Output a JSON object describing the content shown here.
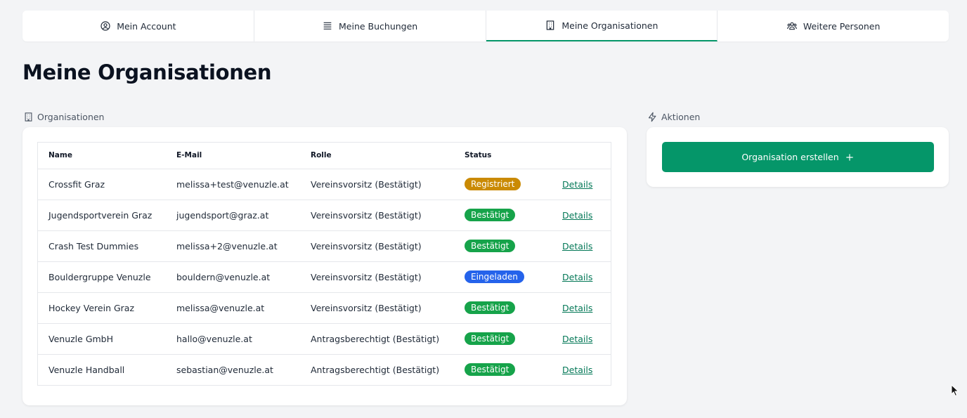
{
  "tabs": [
    {
      "label": "Mein Account",
      "icon": "user-circle-icon"
    },
    {
      "label": "Meine Buchungen",
      "icon": "list-icon"
    },
    {
      "label": "Meine Organisationen",
      "icon": "building-icon",
      "active": true
    },
    {
      "label": "Weitere Personen",
      "icon": "users-icon"
    }
  ],
  "page_title": "Meine Organisationen",
  "orgs_section": {
    "label": "Organisationen",
    "columns": [
      "Name",
      "E-Mail",
      "Rolle",
      "Status",
      ""
    ],
    "rows": [
      {
        "name": "Crossfit Graz",
        "email": "melissa+test@venuzle.at",
        "role": "Vereinsvorsitz (Bestätigt)",
        "status": "Registriert",
        "status_color": "#ca8a04",
        "action": "Details"
      },
      {
        "name": "Jugendsportverein Graz",
        "email": "jugendsport@graz.at",
        "role": "Vereinsvorsitz (Bestätigt)",
        "status": "Bestätigt",
        "status_color": "#16a34a",
        "action": "Details"
      },
      {
        "name": "Crash Test Dummies",
        "email": "melissa+2@venuzle.at",
        "role": "Vereinsvorsitz (Bestätigt)",
        "status": "Bestätigt",
        "status_color": "#16a34a",
        "action": "Details"
      },
      {
        "name": "Bouldergruppe Venuzle",
        "email": "bouldern@venuzle.at",
        "role": "Vereinsvorsitz (Bestätigt)",
        "status": "Eingeladen",
        "status_color": "#2563eb",
        "action": "Details"
      },
      {
        "name": "Hockey Verein Graz",
        "email": "melissa@venuzle.at",
        "role": "Vereinsvorsitz (Bestätigt)",
        "status": "Bestätigt",
        "status_color": "#16a34a",
        "action": "Details"
      },
      {
        "name": "Venuzle GmbH",
        "email": "hallo@venuzle.at",
        "role": "Antragsberechtigt (Bestätigt)",
        "status": "Bestätigt",
        "status_color": "#16a34a",
        "action": "Details"
      },
      {
        "name": "Venuzle Handball",
        "email": "sebastian@venuzle.at",
        "role": "Antragsberechtigt (Bestätigt)",
        "status": "Bestätigt",
        "status_color": "#16a34a",
        "action": "Details"
      }
    ]
  },
  "actions_section": {
    "label": "Aktionen",
    "create_button": "Organisation erstellen"
  },
  "colors": {
    "accent": "#059669",
    "background": "#f3f4f6"
  }
}
